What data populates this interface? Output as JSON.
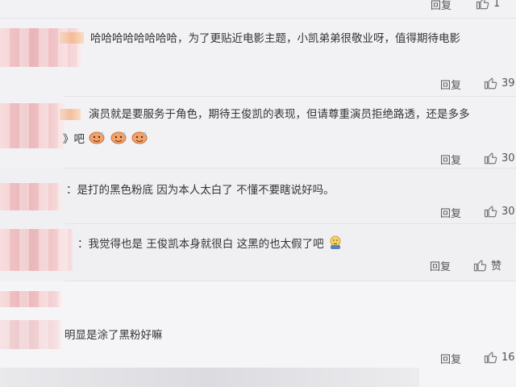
{
  "icons": {
    "like": "thumbs-up-icon",
    "reply": "reply-link"
  },
  "colors": {
    "background": "#f2f2f5",
    "text": "#333333",
    "muted": "#555555",
    "divider": "#e3e3e6"
  },
  "comments": [
    {
      "text": "",
      "reply_label": "回复",
      "like_label": "1"
    },
    {
      "text": "哈哈哈哈哈哈哈哈，为了更贴近电影主题，小凯弟弟很敬业呀，值得期待电影",
      "reply_label": "回复",
      "like_label": "39"
    },
    {
      "text": "演员就是要服务于角色，期待王俊凯的表现，但请尊重演员拒绝路透，还是多多",
      "text2": "》吧",
      "reply_label": "回复",
      "like_label": "30"
    },
    {
      "text": "：是打的黑色粉底 因为本人太白了 不懂不要瞎说好吗。",
      "reply_label": "回复",
      "like_label": "30"
    },
    {
      "text": "：我觉得也是 王俊凯本身就很白 这黑的也太假了吧",
      "reply_label": "回复",
      "like_label": "赞"
    },
    {
      "text": "明显是涂了黑粉好嘛",
      "reply_label": "回复",
      "like_label": "16"
    }
  ]
}
